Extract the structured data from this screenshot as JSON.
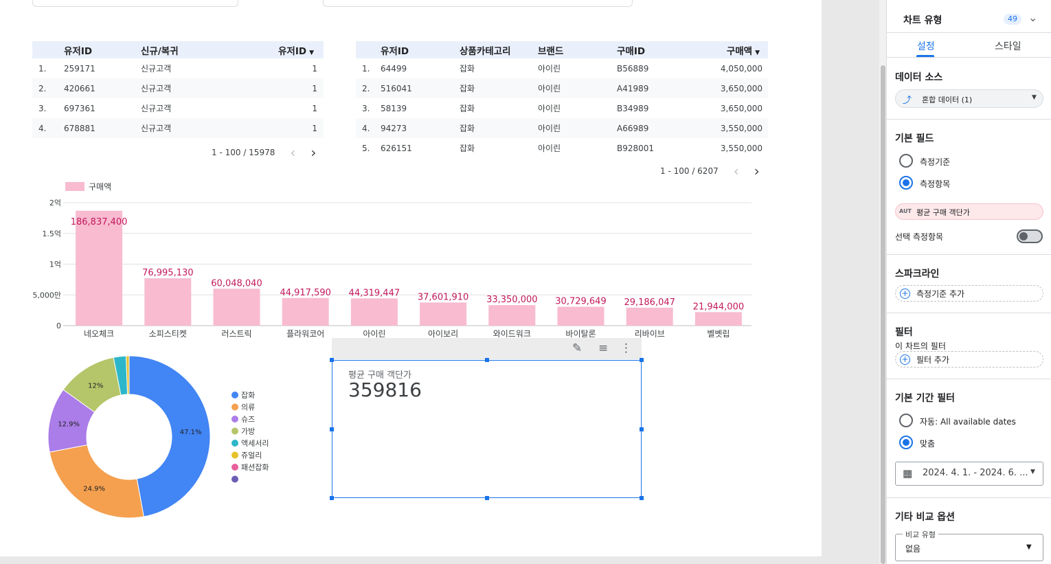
{
  "table1": {
    "headers": [
      "유저ID",
      "신규/복귀",
      "유저ID"
    ],
    "rows": [
      {
        "n": "1.",
        "id": "259171",
        "type": "신규고객",
        "cnt": "1"
      },
      {
        "n": "2.",
        "id": "420661",
        "type": "신규고객",
        "cnt": "1"
      },
      {
        "n": "3.",
        "id": "697361",
        "type": "신규고객",
        "cnt": "1"
      },
      {
        "n": "4.",
        "id": "678881",
        "type": "신규고객",
        "cnt": "1"
      }
    ],
    "pager": "1 - 100 / 15978"
  },
  "table2": {
    "headers": [
      "유저ID",
      "상품카테고리",
      "브랜드",
      "구매ID",
      "구매액"
    ],
    "rows": [
      {
        "n": "1.",
        "id": "64499",
        "cat": "잡화",
        "brand": "아이린",
        "pid": "B56889",
        "amt": "4,050,000"
      },
      {
        "n": "2.",
        "id": "516041",
        "cat": "잡화",
        "brand": "아이린",
        "pid": "A41989",
        "amt": "3,650,000"
      },
      {
        "n": "3.",
        "id": "58139",
        "cat": "잡화",
        "brand": "아이린",
        "pid": "B34989",
        "amt": "3,650,000"
      },
      {
        "n": "4.",
        "id": "94273",
        "cat": "잡화",
        "brand": "아이린",
        "pid": "A66989",
        "amt": "3,550,000"
      },
      {
        "n": "5.",
        "id": "626151",
        "cat": "잡화",
        "brand": "아이린",
        "pid": "B928001",
        "amt": "3,550,000"
      }
    ],
    "pager": "1 - 100 / 6207"
  },
  "chart_data": [
    {
      "type": "bar",
      "legend": "구매액",
      "categories": [
        "네오체크",
        "소피스티켓",
        "러스트릭",
        "플라워코어",
        "아이린",
        "아이보리",
        "와이드워크",
        "바이탈론",
        "리바이브",
        "벨벳립"
      ],
      "values": [
        186837400,
        76995130,
        60048040,
        44917590,
        44319447,
        37601910,
        33350000,
        30729649,
        29186047,
        21944000
      ],
      "value_labels": [
        "186,837,400",
        "76,995,130",
        "60,048,040",
        "44,917,590",
        "44,319,447",
        "37,601,910",
        "33,350,000",
        "30,729,649",
        "29,186,047",
        "21,944,000"
      ],
      "yticks": [
        {
          "v": 0,
          "label": "0"
        },
        {
          "v": 50000000,
          "label": "5,000만"
        },
        {
          "v": 100000000,
          "label": "1억"
        },
        {
          "v": 150000000,
          "label": "1.5억"
        },
        {
          "v": 200000000,
          "label": "2억"
        }
      ],
      "ylim": [
        0,
        200000000
      ],
      "bar_color": "#f8bbd0",
      "label_color": "#c2185b",
      "legend_position": "top-left",
      "grid": true
    },
    {
      "type": "pie",
      "donut": true,
      "slices": [
        {
          "name": "잡화",
          "value": 47.1,
          "color": "#4285f4",
          "label": "47.1%"
        },
        {
          "name": "의류",
          "value": 24.9,
          "color": "#f4a04f",
          "label": "24.9%"
        },
        {
          "name": "슈즈",
          "value": 12.9,
          "color": "#ab7de8",
          "label": "12.9%"
        },
        {
          "name": "가방",
          "value": 12.0,
          "color": "#b5c56a",
          "label": "12%"
        },
        {
          "name": "액세서리",
          "value": 2.5,
          "color": "#2db6c9",
          "label": ""
        },
        {
          "name": "쥬얼리",
          "value": 0.6,
          "color": "#e6c229",
          "label": ""
        },
        {
          "name": "패션잡화",
          "value": 0.0,
          "color": "#e8609b",
          "label": ""
        },
        {
          "name": "",
          "value": 0.0,
          "color": "#6a5fb4",
          "label": ""
        }
      ],
      "legend_position": "right"
    }
  ],
  "scorecard": {
    "label": "평균 구매 객단가",
    "value": "359816"
  },
  "panel": {
    "chart_type_label": "차트 유형",
    "chart_type_badge": "49",
    "tab_setup": "설정",
    "tab_style": "스타일",
    "data_source_title": "데이터 소스",
    "data_source_value": "혼합 데이터 (1)",
    "fields_title": "기본 필드",
    "dimension_label": "측정기준",
    "metric_label": "측정항목",
    "metric_chip_tag": "AUT",
    "metric_chip": "평균 구매 객단가",
    "optional_metric": "선택 측정항목",
    "sparkline_title": "스파크라인",
    "add_dimension": "측정기준 추가",
    "filter_title": "필터",
    "filter_sub": "이 차트의 필터",
    "add_filter": "필터 추가",
    "date_filter_title": "기본 기간 필터",
    "date_auto": "자동: All available dates",
    "date_custom": "맞춤",
    "date_range": "2024. 4. 1. - 2024. 6. ...",
    "compare_title": "기타 비교 옵션",
    "compare_type_label": "비교 유형",
    "compare_type_value": "없음"
  }
}
